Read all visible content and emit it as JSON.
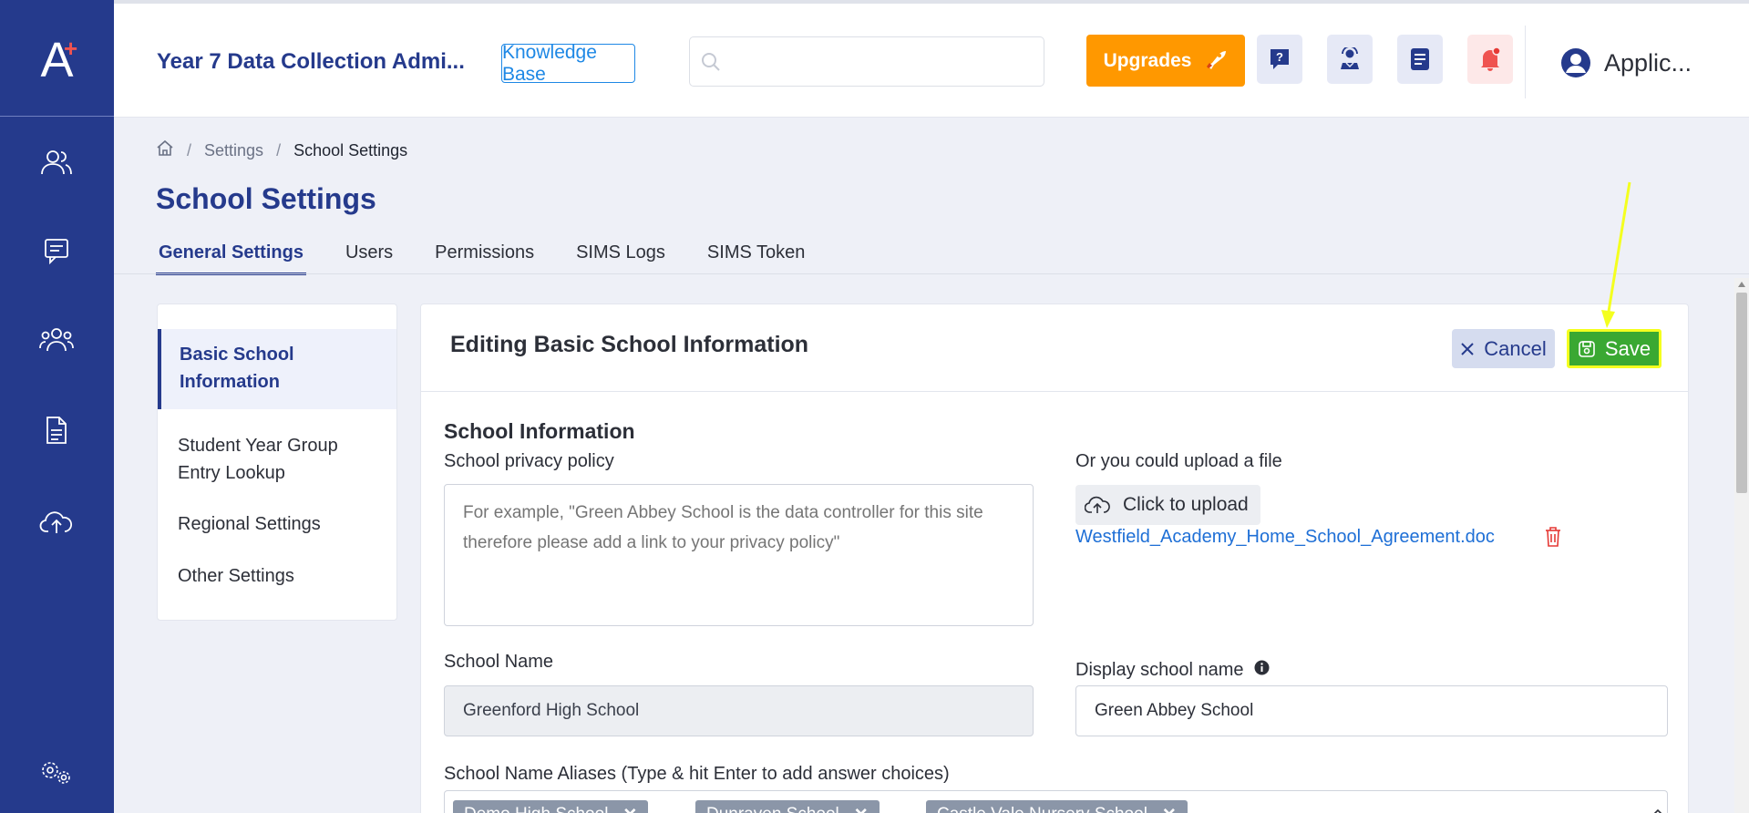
{
  "app": {
    "title": "Year 7 Data Collection Admi...",
    "logo_letter": "A",
    "logo_plus": "+"
  },
  "header": {
    "knowledge_base_label": "Knowledge Base",
    "search_placeholder": "",
    "upgrades_label": "Upgrades",
    "user_name": "Applic..."
  },
  "breadcrumb": {
    "settings": "Settings",
    "current": "School Settings",
    "separator": "/"
  },
  "page": {
    "title": "School Settings"
  },
  "tabs": [
    {
      "label": "General Settings",
      "active": true
    },
    {
      "label": "Users",
      "active": false
    },
    {
      "label": "Permissions",
      "active": false
    },
    {
      "label": "SIMS Logs",
      "active": false
    },
    {
      "label": "SIMS Token",
      "active": false
    }
  ],
  "left_menu": {
    "item0": {
      "line1": "Basic School",
      "line2": "Information"
    },
    "item1": {
      "line1": "Student Year Group",
      "line2": "Entry Lookup"
    },
    "item2": "Regional Settings",
    "item3": "Other Settings"
  },
  "panel": {
    "title": "Editing Basic School Information",
    "cancel_label": "Cancel",
    "save_label": "Save"
  },
  "form": {
    "section_title": "School Information",
    "privacy_label": "School privacy policy",
    "privacy_placeholder": "For example, \"Green Abbey School is the data controller for this site therefore please add a link to your privacy policy\"",
    "upload_label": "Or you could upload a file",
    "upload_button": "Click to upload",
    "uploaded_file": "Westfield_Academy_Home_School_Agreement.doc",
    "school_name_label": "School Name",
    "school_name_value": "Greenford High School",
    "display_name_label": "Display school name",
    "display_name_value": "Green Abbey School",
    "aliases_label": "School Name Aliases (Type & hit Enter to add answer choices)",
    "aliases": [
      "Demo High School",
      "Dunraven School",
      "Castle Vale Nursery School"
    ]
  },
  "colors": {
    "sidebar": "#253a8c",
    "primary": "#253a8c",
    "upgrade": "#ff9800",
    "save": "#3aa832",
    "highlight": "#f4ff1f",
    "link": "#1e6fd6"
  },
  "icons": {
    "sidebar": [
      "users-icon",
      "chat-icon",
      "group-icon",
      "document-icon",
      "cloud-upload-icon",
      "settings-icon"
    ],
    "header": [
      "help-icon",
      "support-icon",
      "notes-icon",
      "bell-icon",
      "user-avatar-icon"
    ]
  }
}
